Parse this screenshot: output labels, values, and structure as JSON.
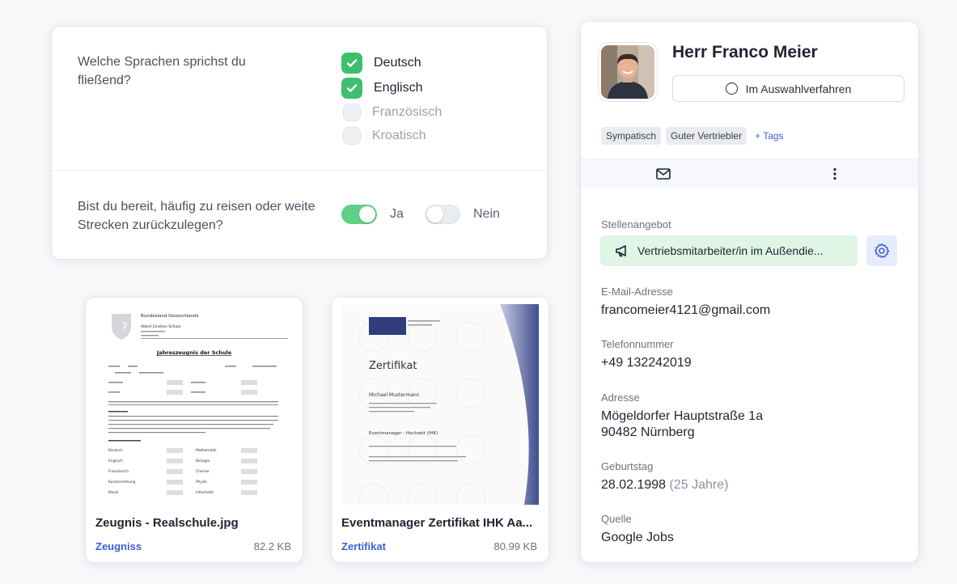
{
  "questions": {
    "q1_text": "Welche Sprachen sprichst du fließend?",
    "languages": [
      {
        "label": "Deutsch",
        "checked": true
      },
      {
        "label": "Englisch",
        "checked": true
      },
      {
        "label": "Französisch",
        "checked": false
      },
      {
        "label": "Kroatisch",
        "checked": false
      }
    ],
    "q2_text": "Bist du bereit, häufig zu reisen oder weite Strecken zurückzulegen?",
    "yes_label": "Ja",
    "no_label": "Nein",
    "yes_selected": true
  },
  "documents": [
    {
      "name": "Zeugnis - Realschule.jpg",
      "type": "Zeugniss",
      "size": "82.2 KB"
    },
    {
      "name": "Eventmanager Zertifikat IHK Aa...",
      "type": "Zertifikat",
      "size": "80.99 KB"
    }
  ],
  "doc_previews": {
    "zeugnis": {
      "state": "Bundesland Deutschlands",
      "school": "Albert Einstein Schule",
      "title": "Jahreszeugnis der Schule",
      "subjects_left": [
        "Deutsch",
        "Englisch",
        "Französisch",
        "Kunsterziehung",
        "Musik"
      ],
      "subjects_right": [
        "Mathematik",
        "Biologie",
        "Chemie",
        "Physik",
        "Informatik"
      ]
    },
    "zertifikat": {
      "title": "Zertifikat",
      "holder": "Michael Mustermann",
      "course": "Eventmanager - Hochzeit (IHK)"
    }
  },
  "profile": {
    "name": "Herr Franco Meier",
    "status": "Im Auswahlverfahren",
    "tags": [
      "Sympatisch",
      "Guter Vertriebler"
    ],
    "add_tag": "+ Tags",
    "job_label": "Stellenangebot",
    "job_value": "Vertriebsmitarbeiter/in im Außendie...",
    "email_label": "E-Mail-Adresse",
    "email": "francomeier4121@gmail.com",
    "phone_label": "Telefonnummer",
    "phone": "+49 132242019",
    "address_label": "Adresse",
    "address_line1": "Mögeldorfer Hauptstraße 1a",
    "address_line2": "90482 Nürnberg",
    "birthday_label": "Geburtstag",
    "birthday": "28.02.1998",
    "age": "(25 Jahre)",
    "source_label": "Quelle",
    "source": "Google Jobs"
  },
  "colors": {
    "accent": "#3d5fd9",
    "check_green": "#3dbf6e",
    "job_bg": "#dff5e6"
  },
  "icons": [
    "check-icon",
    "mail-icon",
    "more-vertical-icon",
    "megaphone-icon",
    "gear-icon",
    "circle-icon"
  ]
}
